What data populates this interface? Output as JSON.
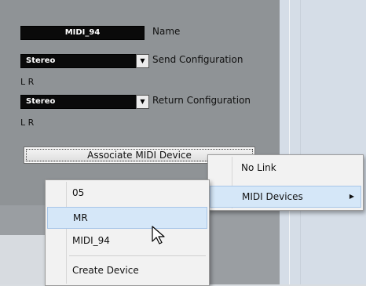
{
  "panel": {
    "name_value": "MIDI_94",
    "name_label": "Name",
    "send": {
      "value": "Stereo",
      "label": "Send Configuration",
      "channels": "L R"
    },
    "return": {
      "value": "Stereo",
      "label": "Return Configuration",
      "channels": "L R"
    },
    "associate_button": "Associate MIDI Device"
  },
  "link_menu": {
    "items": [
      {
        "label": "No Link"
      },
      {
        "label": "MIDI Devices",
        "has_submenu": true
      }
    ]
  },
  "device_menu": {
    "items": [
      {
        "label": "05"
      },
      {
        "label": "MR",
        "highlighted": true
      },
      {
        "label": "MIDI_94"
      },
      {
        "label": "Create Device"
      }
    ]
  },
  "icons": {
    "dropdown": "chevron-down-icon",
    "submenu": "chevron-right-icon",
    "cursor": "mouse-pointer-icon"
  },
  "colors": {
    "panel_bg": "#8f9396",
    "field_bg": "#0a0a0a",
    "highlight_bg": "#d5e7f8",
    "highlight_border": "#a8c6e8"
  }
}
